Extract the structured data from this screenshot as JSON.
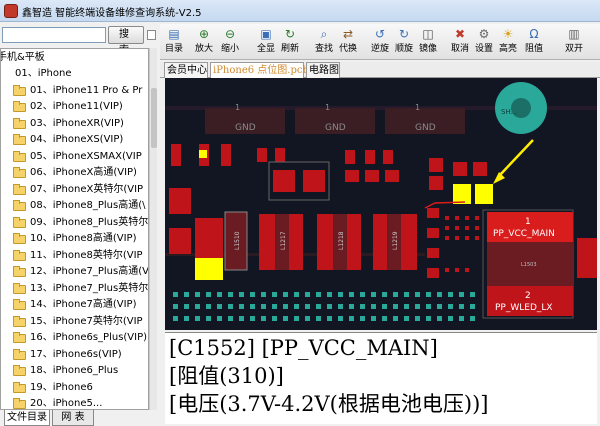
{
  "window": {
    "title": "鑫智造 智能终端设备维修查询系统-V2.5"
  },
  "search": {
    "button_label": "搜 索",
    "value": ""
  },
  "tree": {
    "root_label": "手机&平板",
    "items": [
      {
        "label": "01、iPhone",
        "folder": false
      },
      {
        "label": "01、iPhone11 Pro & Pr",
        "folder": true
      },
      {
        "label": "02、iPhone11(VIP)",
        "folder": true
      },
      {
        "label": "03、iPhoneXR(VIP)",
        "folder": true
      },
      {
        "label": "04、iPhoneXS(VIP)",
        "folder": true
      },
      {
        "label": "05、iPhoneXSMAX(VIP",
        "folder": true
      },
      {
        "label": "06、iPhoneX高通(VIP)",
        "folder": true
      },
      {
        "label": "07、iPhoneX英特尔(VIP",
        "folder": true
      },
      {
        "label": "08、iPhone8_Plus高通(\\",
        "folder": true
      },
      {
        "label": "09、iPhone8_Plus英特尔",
        "folder": true
      },
      {
        "label": "10、iPhone8高通(VIP)",
        "folder": true
      },
      {
        "label": "11、iPhone8英特尔(VIP",
        "folder": true
      },
      {
        "label": "12、iPhone7_Plus高通(V",
        "folder": true
      },
      {
        "label": "13、iPhone7_Plus英特尔",
        "folder": true
      },
      {
        "label": "14、iPhone7高通(VIP)",
        "folder": true
      },
      {
        "label": "15、iPhone7英特尔(VIP",
        "folder": true
      },
      {
        "label": "16、iPhone6s_Plus(VIP)",
        "folder": true
      },
      {
        "label": "17、iPhone6s(VIP)",
        "folder": true
      },
      {
        "label": "18、iPhone6_Plus",
        "folder": true
      },
      {
        "label": "19、iPhone6",
        "folder": true
      },
      {
        "label": "20、iPhone5...",
        "folder": true
      }
    ]
  },
  "bottom_tabs": [
    "文件目录",
    "网 表"
  ],
  "toolbar": [
    {
      "label": "目录",
      "icon": "catalog-icon"
    },
    {
      "label": "放大",
      "icon": "zoom-in-icon"
    },
    {
      "label": "缩小",
      "icon": "zoom-out-icon"
    },
    {
      "label": "全显",
      "icon": "fit-all-icon"
    },
    {
      "label": "刷新",
      "icon": "refresh-icon"
    },
    {
      "label": "查找",
      "icon": "find-icon"
    },
    {
      "label": "代换",
      "icon": "replace-icon"
    },
    {
      "label": "逆旋",
      "icon": "rotate-ccw-icon"
    },
    {
      "label": "顺旋",
      "icon": "rotate-cw-icon"
    },
    {
      "label": "镜像",
      "icon": "mirror-icon"
    },
    {
      "label": "取消",
      "icon": "cancel-icon"
    },
    {
      "label": "设置",
      "icon": "settings-icon"
    },
    {
      "label": "高亮",
      "icon": "highlight-icon"
    },
    {
      "label": "阻值",
      "icon": "resistance-icon"
    },
    {
      "label": "双开",
      "icon": "dual-open-icon"
    }
  ],
  "doc_tabs": [
    {
      "label": "会员中心",
      "active": false
    },
    {
      "label": "iPhone6 点位图.pcb",
      "active": true
    },
    {
      "label": "电路图",
      "active": false
    }
  ],
  "pcb": {
    "gnd_label": "GND",
    "pad1_number": "1",
    "pad1_net": "PP_VCC_MAIN",
    "pad2_number": "2",
    "pad2_net": "PP_WLED_LX",
    "center_part": "L1503",
    "parts": [
      "L1510",
      "L1217",
      "L1218",
      "L1219"
    ],
    "corner_label": "SH..."
  },
  "info": {
    "line1": "[C1552] [PP_VCC_MAIN]",
    "line2": "[阻值(310)]",
    "line3": "[电压(3.7V-4.2V(根据电池电压))]"
  },
  "colors": {
    "pcb_bg": "#121522",
    "pad_red": "#c0141b",
    "pad_yellow": "#ffff00",
    "highlight_red": "#d91c1c",
    "teal": "#2aa89a"
  }
}
